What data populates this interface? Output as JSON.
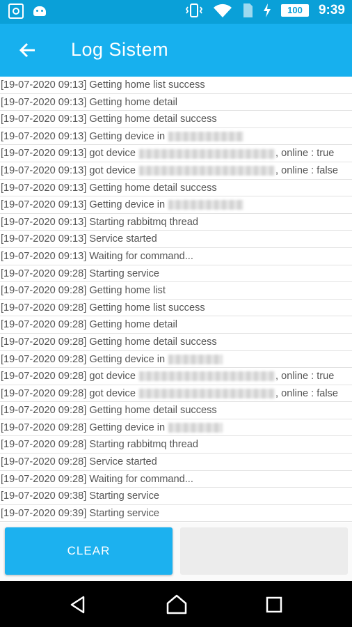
{
  "status_bar": {
    "battery": "100",
    "time": "9:39",
    "icons": [
      "app-icon",
      "android-icon",
      "vibrate-icon",
      "wifi-icon",
      "sim-icon",
      "charging-icon",
      "battery-icon"
    ]
  },
  "toolbar": {
    "title": "Log Sistem",
    "back_icon": "arrow-back-icon"
  },
  "log": [
    {
      "time": "[19-07-2020 09:13]",
      "msg": "Getting home list success"
    },
    {
      "time": "[19-07-2020 09:13]",
      "msg": "Getting home detail"
    },
    {
      "time": "[19-07-2020 09:13]",
      "msg": "Getting home detail success"
    },
    {
      "time": "[19-07-2020 09:13]",
      "msg": "Getting device in",
      "blur": true
    },
    {
      "time": "[19-07-2020 09:13]",
      "msg": "got device",
      "blur": true,
      "after": ", online : true"
    },
    {
      "time": "[19-07-2020 09:13]",
      "msg": "got device",
      "blur": true,
      "after": ", online : false"
    },
    {
      "time": "[19-07-2020 09:13]",
      "msg": "Getting home detail success"
    },
    {
      "time": "[19-07-2020 09:13]",
      "msg": "Getting device in",
      "blur": true
    },
    {
      "time": "[19-07-2020 09:13]",
      "msg": "Starting rabbitmq thread"
    },
    {
      "time": "[19-07-2020 09:13]",
      "msg": "Service started"
    },
    {
      "time": "[19-07-2020 09:13]",
      "msg": "Waiting for command..."
    },
    {
      "time": "[19-07-2020 09:28]",
      "msg": "Starting service"
    },
    {
      "time": "[19-07-2020 09:28]",
      "msg": "Getting home list"
    },
    {
      "time": "[19-07-2020 09:28]",
      "msg": "Getting home list success"
    },
    {
      "time": "[19-07-2020 09:28]",
      "msg": "Getting home detail"
    },
    {
      "time": "[19-07-2020 09:28]",
      "msg": "Getting home detail success"
    },
    {
      "time": "[19-07-2020 09:28]",
      "msg": "Getting device in",
      "blur": true
    },
    {
      "time": "[19-07-2020 09:28]",
      "msg": "got device",
      "blur": true,
      "after": ", online : true"
    },
    {
      "time": "[19-07-2020 09:28]",
      "msg": "got device",
      "blur": true,
      "after": ", online : false"
    },
    {
      "time": "[19-07-2020 09:28]",
      "msg": "Getting home detail success"
    },
    {
      "time": "[19-07-2020 09:28]",
      "msg": "Getting device in",
      "blur": true
    },
    {
      "time": "[19-07-2020 09:28]",
      "msg": "Starting rabbitmq thread"
    },
    {
      "time": "[19-07-2020 09:28]",
      "msg": "Service started"
    },
    {
      "time": "[19-07-2020 09:28]",
      "msg": "Waiting for command..."
    },
    {
      "time": "[19-07-2020 09:38]",
      "msg": "Starting service"
    },
    {
      "time": "[19-07-2020 09:39]",
      "msg": "Starting service"
    }
  ],
  "buttons": {
    "clear": "CLEAR"
  },
  "nav": {
    "icons": [
      "back-icon",
      "home-icon",
      "recents-icon"
    ]
  },
  "colors": {
    "status_bar": "#0aa0d8",
    "toolbar": "#17b0ee",
    "button": "#1cb1ef"
  }
}
